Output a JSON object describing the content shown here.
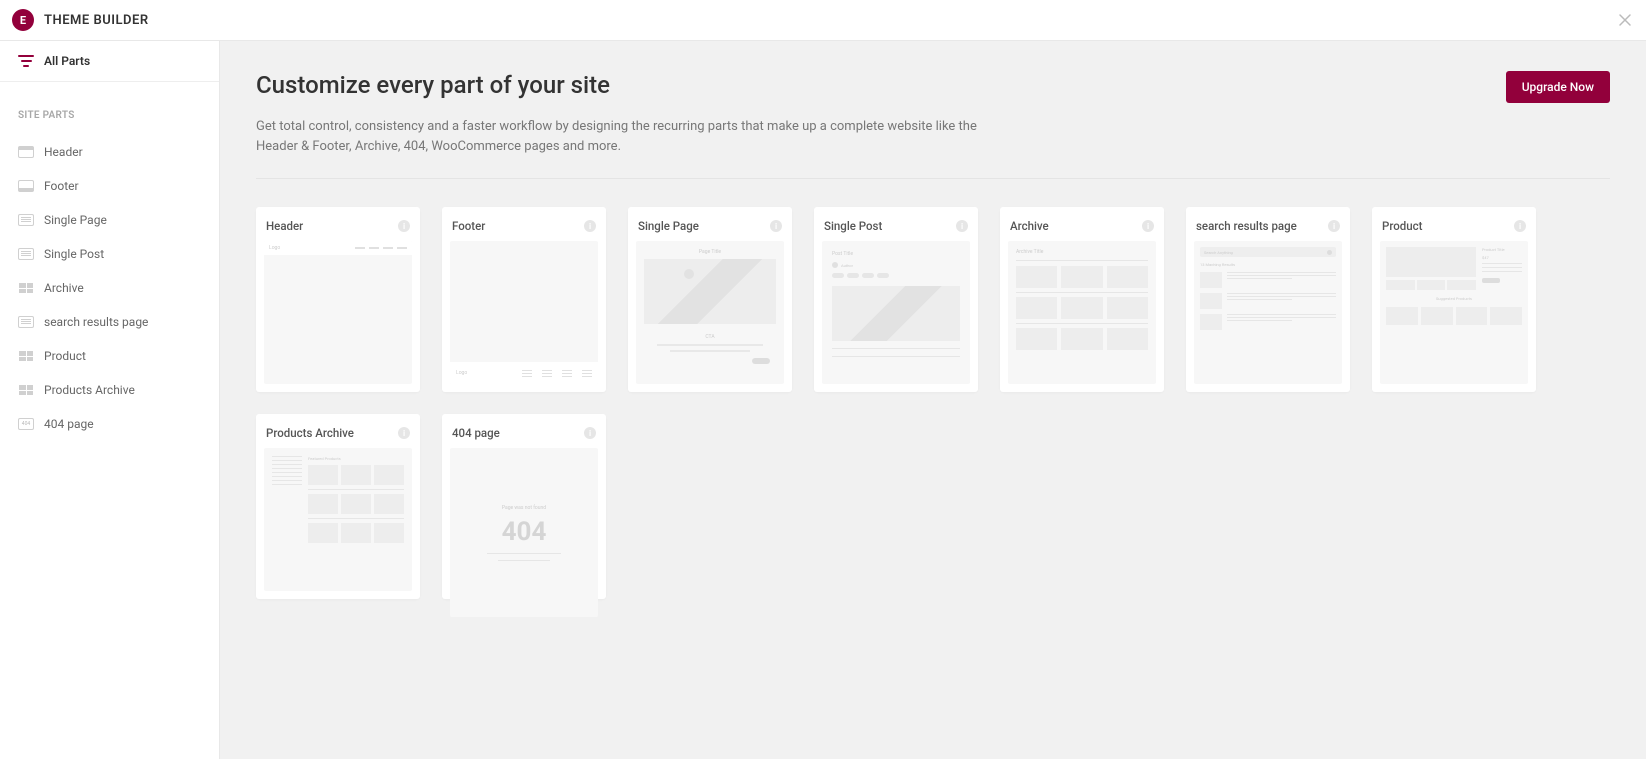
{
  "topbar": {
    "title": "THEME BUILDER"
  },
  "sidebar": {
    "all_parts": "All Parts",
    "section_title": "SITE PARTS",
    "items": [
      {
        "label": "Header"
      },
      {
        "label": "Footer"
      },
      {
        "label": "Single Page"
      },
      {
        "label": "Single Post"
      },
      {
        "label": "Archive"
      },
      {
        "label": "search results page"
      },
      {
        "label": "Product"
      },
      {
        "label": "Products Archive"
      },
      {
        "label": "404 page"
      }
    ]
  },
  "main": {
    "heading": "Customize every part of your site",
    "description": "Get total control, consistency and a faster workflow by designing the recurring parts that make up a complete website like the Header & Footer, Archive, 404, WooCommerce pages and more.",
    "upgrade_label": "Upgrade Now"
  },
  "cards": [
    {
      "title": "Header"
    },
    {
      "title": "Footer"
    },
    {
      "title": "Single Page"
    },
    {
      "title": "Single Post"
    },
    {
      "title": "Archive"
    },
    {
      "title": "search results page"
    },
    {
      "title": "Product"
    },
    {
      "title": "Products Archive"
    },
    {
      "title": "404 page"
    }
  ],
  "preview_text": {
    "logo": "Logo",
    "page_title": "Page Title",
    "cta": "CTA",
    "post_title": "Post Title",
    "author": "Author",
    "archive_title": "Archive Title",
    "search_placeholder": "Search Anything",
    "matching_results": "13 Maching Results",
    "product_title": "Product Title",
    "price": "$47",
    "suggested": "Suggested Products",
    "featured": "Featured Products",
    "not_found_msg": "Page was not found",
    "not_found_code": "404"
  }
}
